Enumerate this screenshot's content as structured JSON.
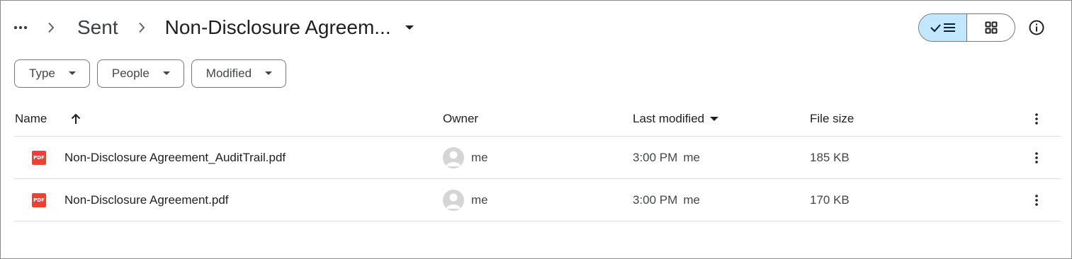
{
  "breadcrumb": {
    "parent": "Sent",
    "current": "Non-Disclosure Agreem..."
  },
  "filters": [
    {
      "label": "Type"
    },
    {
      "label": "People"
    },
    {
      "label": "Modified"
    }
  ],
  "table": {
    "headers": {
      "name": "Name",
      "owner": "Owner",
      "last_modified": "Last modified",
      "file_size": "File size"
    },
    "rows": [
      {
        "name": "Non-Disclosure Agreement_AuditTrail.pdf",
        "icon": "pdf-icon",
        "icon_text": "PDF",
        "owner": "me",
        "modified_time": "3:00 PM",
        "modified_by": "me",
        "size": "185 KB"
      },
      {
        "name": "Non-Disclosure Agreement.pdf",
        "icon": "pdf-icon",
        "icon_text": "PDF",
        "owner": "me",
        "modified_time": "3:00 PM",
        "modified_by": "me",
        "size": "170 KB"
      }
    ]
  },
  "colors": {
    "accent_toggle": "#c2e7ff",
    "pdf_red": "#ea4335",
    "border": "#747775"
  }
}
